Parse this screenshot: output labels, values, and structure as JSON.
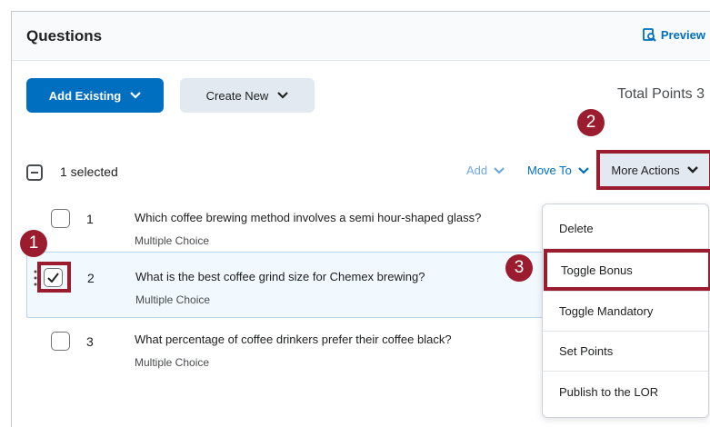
{
  "header": {
    "title": "Questions",
    "preview_label": "Preview"
  },
  "actions": {
    "add_existing": "Add Existing",
    "create_new": "Create New",
    "total_points": "Total Points 3"
  },
  "toolbar": {
    "selected": "1 selected",
    "add": "Add",
    "move_to": "Move To",
    "more_actions": "More Actions"
  },
  "questions": [
    {
      "num": "1",
      "text": "Which coffee brewing method involves a semi hour-shaped glass?",
      "type": "Multiple Choice"
    },
    {
      "num": "2",
      "text": "What is the best coffee grind size for Chemex brewing?",
      "type": "Multiple Choice"
    },
    {
      "num": "3",
      "text": "What percentage of coffee drinkers prefer their coffee black?",
      "type": "Multiple Choice"
    }
  ],
  "menu": [
    "Delete",
    "Toggle Bonus",
    "Toggle Mandatory",
    "Set Points",
    "Publish to the LOR"
  ],
  "callouts": [
    "1",
    "2",
    "3"
  ],
  "colors": {
    "primary": "#006fbf",
    "callout": "#9a1c2e",
    "secondary_bg": "#e3e9f1"
  }
}
